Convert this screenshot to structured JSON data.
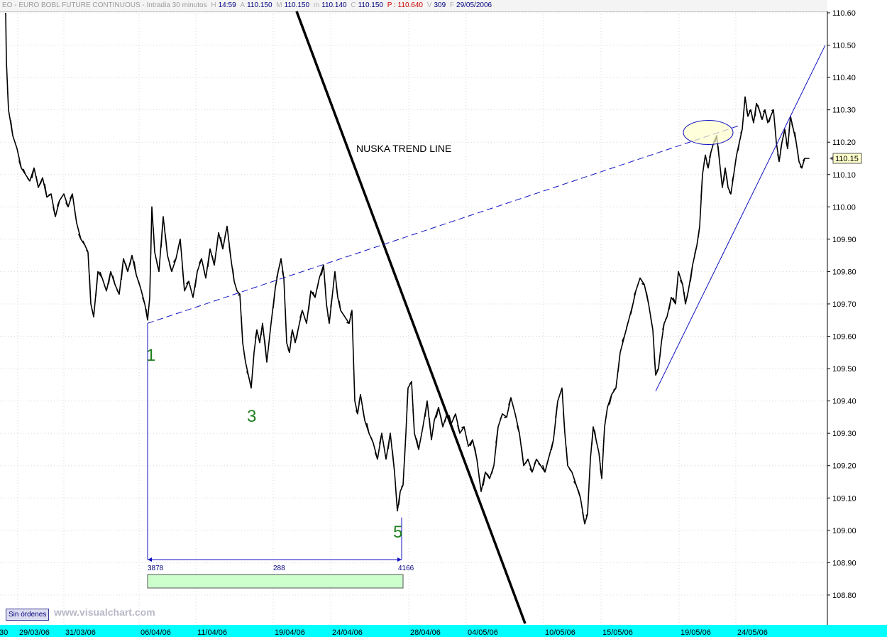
{
  "header": {
    "title": "EO - EURO BOBL FUTURE CONTINUOUS - Intradia 30 minutos",
    "fields": [
      {
        "label": "H",
        "value": "14:59",
        "color": "#00007f"
      },
      {
        "label": "A",
        "value": "110.150",
        "color": "#00007f"
      },
      {
        "label": "M",
        "value": "110.150",
        "color": "#00007f"
      },
      {
        "label": "m",
        "value": "110.140",
        "color": "#00007f"
      },
      {
        "label": "C",
        "value": "110.150",
        "color": "#00007f"
      },
      {
        "label": "",
        "value": "P : 110.640",
        "color": "#cc0000"
      },
      {
        "label": "V",
        "value": "309",
        "color": "#00007f"
      },
      {
        "label": "F",
        "value": "29/05/2006",
        "color": "#00007f"
      }
    ]
  },
  "footer": {
    "orders_button": "Sin órdenes",
    "watermark": "www.visualchart.com"
  },
  "chart_data": {
    "type": "line",
    "title": "",
    "xlabel": "",
    "ylabel": "",
    "ylim": [
      108.7,
      110.6
    ],
    "grid": true,
    "current_price": "110.15",
    "yticks": [
      "110.60",
      "110.50",
      "110.40",
      "110.30",
      "110.20",
      "110.10",
      "110.00",
      "109.90",
      "109.80",
      "109.70",
      "109.60",
      "109.50",
      "109.40",
      "109.30",
      "109.20",
      "109.10",
      "109.00",
      "108.90",
      "108.80"
    ],
    "xticks": [
      {
        "label": "30",
        "bar": -3
      },
      {
        "label": "29/03/06",
        "bar": 25
      },
      {
        "label": "31/03/06",
        "bar": 90
      },
      {
        "label": "06/04/06",
        "bar": 196
      },
      {
        "label": "11/04/06",
        "bar": 276
      },
      {
        "label": "19/04/06",
        "bar": 385
      },
      {
        "label": "24/04/06",
        "bar": 466
      },
      {
        "label": "28/04/06",
        "bar": 576
      },
      {
        "label": "04/05/06",
        "bar": 657
      },
      {
        "label": "10/05/06",
        "bar": 766
      },
      {
        "label": "15/05/06",
        "bar": 847
      },
      {
        "label": "19/05/06",
        "bar": 957
      },
      {
        "label": "24/05/06",
        "bar": 1037
      }
    ],
    "price_path": [
      [
        8,
        110.6
      ],
      [
        9,
        110.45
      ],
      [
        12,
        110.3
      ],
      [
        18,
        110.22
      ],
      [
        24,
        110.18
      ],
      [
        30,
        110.12
      ],
      [
        36,
        110.1
      ],
      [
        42,
        110.08
      ],
      [
        48,
        110.12
      ],
      [
        54,
        110.06
      ],
      [
        60,
        110.09
      ],
      [
        66,
        110.03
      ],
      [
        72,
        110.04
      ],
      [
        78,
        109.97
      ],
      [
        84,
        110.02
      ],
      [
        90,
        110.04
      ],
      [
        96,
        110.0
      ],
      [
        102,
        110.04
      ],
      [
        108,
        109.95
      ],
      [
        114,
        109.9
      ],
      [
        120,
        109.88
      ],
      [
        124,
        109.86
      ],
      [
        128,
        109.7
      ],
      [
        132,
        109.66
      ],
      [
        138,
        109.8
      ],
      [
        144,
        109.78
      ],
      [
        150,
        109.74
      ],
      [
        156,
        109.8
      ],
      [
        162,
        109.76
      ],
      [
        168,
        109.73
      ],
      [
        174,
        109.84
      ],
      [
        180,
        109.8
      ],
      [
        186,
        109.85
      ],
      [
        192,
        109.79
      ],
      [
        198,
        109.75
      ],
      [
        204,
        109.7
      ],
      [
        208,
        109.65
      ],
      [
        211,
        109.72
      ],
      [
        214,
        110.0
      ],
      [
        218,
        109.86
      ],
      [
        224,
        109.8
      ],
      [
        230,
        109.97
      ],
      [
        236,
        109.85
      ],
      [
        242,
        109.8
      ],
      [
        248,
        109.84
      ],
      [
        254,
        109.9
      ],
      [
        260,
        109.74
      ],
      [
        266,
        109.77
      ],
      [
        272,
        109.72
      ],
      [
        278,
        109.8
      ],
      [
        284,
        109.84
      ],
      [
        290,
        109.78
      ],
      [
        296,
        109.87
      ],
      [
        302,
        109.82
      ],
      [
        308,
        109.92
      ],
      [
        314,
        109.87
      ],
      [
        320,
        109.94
      ],
      [
        326,
        109.83
      ],
      [
        330,
        109.77
      ],
      [
        334,
        109.74
      ],
      [
        338,
        109.73
      ],
      [
        342,
        109.58
      ],
      [
        346,
        109.52
      ],
      [
        350,
        109.48
      ],
      [
        354,
        109.44
      ],
      [
        358,
        109.55
      ],
      [
        362,
        109.62
      ],
      [
        366,
        109.58
      ],
      [
        370,
        109.64
      ],
      [
        376,
        109.52
      ],
      [
        382,
        109.64
      ],
      [
        388,
        109.75
      ],
      [
        392,
        109.8
      ],
      [
        396,
        109.84
      ],
      [
        400,
        109.78
      ],
      [
        404,
        109.58
      ],
      [
        408,
        109.55
      ],
      [
        412,
        109.62
      ],
      [
        416,
        109.58
      ],
      [
        420,
        109.62
      ],
      [
        426,
        109.68
      ],
      [
        432,
        109.64
      ],
      [
        438,
        109.74
      ],
      [
        444,
        109.72
      ],
      [
        450,
        109.78
      ],
      [
        456,
        109.82
      ],
      [
        460,
        109.7
      ],
      [
        464,
        109.64
      ],
      [
        468,
        109.72
      ],
      [
        472,
        109.8
      ],
      [
        476,
        109.72
      ],
      [
        480,
        109.68
      ],
      [
        486,
        109.66
      ],
      [
        492,
        109.64
      ],
      [
        496,
        109.68
      ],
      [
        500,
        109.4
      ],
      [
        504,
        109.36
      ],
      [
        508,
        109.42
      ],
      [
        514,
        109.34
      ],
      [
        520,
        109.3
      ],
      [
        526,
        109.27
      ],
      [
        532,
        109.22
      ],
      [
        538,
        109.3
      ],
      [
        544,
        109.22
      ],
      [
        550,
        109.3
      ],
      [
        556,
        109.18
      ],
      [
        560,
        109.06
      ],
      [
        564,
        109.12
      ],
      [
        568,
        109.14
      ],
      [
        572,
        109.3
      ],
      [
        575,
        109.44
      ],
      [
        580,
        109.46
      ],
      [
        584,
        109.3
      ],
      [
        590,
        109.25
      ],
      [
        596,
        109.32
      ],
      [
        602,
        109.4
      ],
      [
        608,
        109.28
      ],
      [
        612,
        109.34
      ],
      [
        618,
        109.38
      ],
      [
        624,
        109.32
      ],
      [
        630,
        109.36
      ],
      [
        636,
        109.33
      ],
      [
        642,
        109.36
      ],
      [
        648,
        109.3
      ],
      [
        654,
        109.32
      ],
      [
        660,
        109.26
      ],
      [
        666,
        109.28
      ],
      [
        672,
        109.22
      ],
      [
        678,
        109.12
      ],
      [
        684,
        109.18
      ],
      [
        690,
        109.16
      ],
      [
        696,
        109.2
      ],
      [
        702,
        109.32
      ],
      [
        708,
        109.36
      ],
      [
        714,
        109.35
      ],
      [
        720,
        109.41
      ],
      [
        726,
        109.36
      ],
      [
        732,
        109.3
      ],
      [
        738,
        109.2
      ],
      [
        744,
        109.22
      ],
      [
        750,
        109.18
      ],
      [
        756,
        109.22
      ],
      [
        762,
        109.2
      ],
      [
        768,
        109.18
      ],
      [
        774,
        109.23
      ],
      [
        780,
        109.28
      ],
      [
        786,
        109.4
      ],
      [
        792,
        109.44
      ],
      [
        796,
        109.3
      ],
      [
        800,
        109.2
      ],
      [
        806,
        109.18
      ],
      [
        812,
        109.14
      ],
      [
        818,
        109.1
      ],
      [
        824,
        109.02
      ],
      [
        828,
        109.05
      ],
      [
        832,
        109.22
      ],
      [
        836,
        109.32
      ],
      [
        840,
        109.28
      ],
      [
        844,
        109.24
      ],
      [
        848,
        109.16
      ],
      [
        852,
        109.32
      ],
      [
        856,
        109.38
      ],
      [
        862,
        109.42
      ],
      [
        868,
        109.44
      ],
      [
        874,
        109.55
      ],
      [
        880,
        109.6
      ],
      [
        886,
        109.65
      ],
      [
        892,
        109.7
      ],
      [
        896,
        109.74
      ],
      [
        902,
        109.78
      ],
      [
        908,
        109.76
      ],
      [
        914,
        109.7
      ],
      [
        920,
        109.62
      ],
      [
        924,
        109.48
      ],
      [
        928,
        109.5
      ],
      [
        932,
        109.58
      ],
      [
        936,
        109.64
      ],
      [
        940,
        109.66
      ],
      [
        946,
        109.72
      ],
      [
        952,
        109.7
      ],
      [
        956,
        109.8
      ],
      [
        962,
        109.76
      ],
      [
        966,
        109.7
      ],
      [
        970,
        109.74
      ],
      [
        976,
        109.82
      ],
      [
        982,
        109.88
      ],
      [
        986,
        109.94
      ],
      [
        990,
        110.1
      ],
      [
        994,
        110.16
      ],
      [
        998,
        110.12
      ],
      [
        1002,
        110.17
      ],
      [
        1006,
        110.2
      ],
      [
        1010,
        110.22
      ],
      [
        1014,
        110.14
      ],
      [
        1018,
        110.06
      ],
      [
        1022,
        110.12
      ],
      [
        1026,
        110.06
      ],
      [
        1030,
        110.04
      ],
      [
        1034,
        110.1
      ],
      [
        1038,
        110.16
      ],
      [
        1042,
        110.2
      ],
      [
        1046,
        110.24
      ],
      [
        1050,
        110.34
      ],
      [
        1054,
        110.28
      ],
      [
        1058,
        110.3
      ],
      [
        1062,
        110.26
      ],
      [
        1066,
        110.32
      ],
      [
        1070,
        110.3
      ],
      [
        1074,
        110.27
      ],
      [
        1078,
        110.3
      ],
      [
        1082,
        110.26
      ],
      [
        1086,
        110.28
      ],
      [
        1090,
        110.3
      ],
      [
        1094,
        110.2
      ],
      [
        1098,
        110.14
      ],
      [
        1102,
        110.2
      ],
      [
        1106,
        110.24
      ],
      [
        1110,
        110.18
      ],
      [
        1114,
        110.28
      ],
      [
        1118,
        110.24
      ],
      [
        1122,
        110.2
      ],
      [
        1126,
        110.14
      ],
      [
        1130,
        110.12
      ],
      [
        1134,
        110.15
      ],
      [
        1140,
        110.15
      ]
    ],
    "annotations": {
      "trend_label": "NUSKA TREND LINE",
      "wave_labels": [
        "1",
        "3",
        "5"
      ],
      "measure_left": "3878",
      "measure_mid": "288",
      "measure_right": "4166"
    }
  }
}
